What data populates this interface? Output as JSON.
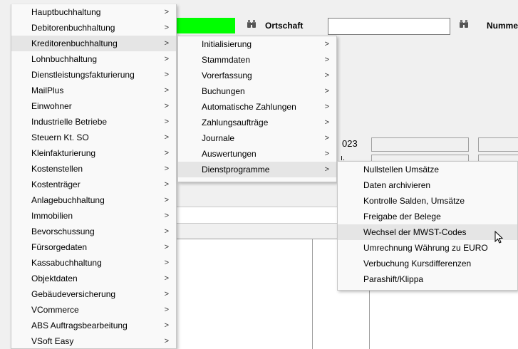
{
  "background": {
    "green_field_color": "#00ff00",
    "ortschaft_label": "Ortschaft",
    "nummer_label": "Nummer",
    "partial_value": "023",
    "partial_value2": "ı."
  },
  "menu_level1": {
    "items": [
      {
        "label": "Hauptbuchhaltung",
        "arrow": ">"
      },
      {
        "label": "Debitorenbuchhaltung",
        "arrow": ">"
      },
      {
        "label": "Kreditorenbuchhaltung",
        "arrow": ">"
      },
      {
        "label": "Lohnbuchhaltung",
        "arrow": ">"
      },
      {
        "label": "Dienstleistungsfakturierung",
        "arrow": ">"
      },
      {
        "label": "MailPlus",
        "arrow": ">"
      },
      {
        "label": "Einwohner",
        "arrow": ">"
      },
      {
        "label": "Industrielle Betriebe",
        "arrow": ">"
      },
      {
        "label": "Steuern Kt. SO",
        "arrow": ">"
      },
      {
        "label": "Kleinfakturierung",
        "arrow": ">"
      },
      {
        "label": "Kostenstellen",
        "arrow": ">"
      },
      {
        "label": "Kostenträger",
        "arrow": ">"
      },
      {
        "label": "Anlagebuchhaltung",
        "arrow": ">"
      },
      {
        "label": "Immobilien",
        "arrow": ">"
      },
      {
        "label": "Bevorschussung",
        "arrow": ">"
      },
      {
        "label": "Fürsorgedaten",
        "arrow": ">"
      },
      {
        "label": "Kassabuchhaltung",
        "arrow": ">"
      },
      {
        "label": "Objektdaten",
        "arrow": ">"
      },
      {
        "label": "Gebäudeversicherung",
        "arrow": ">"
      },
      {
        "label": "VCommerce",
        "arrow": ">"
      },
      {
        "label": "ABS Auftragsbearbeitung",
        "arrow": ">"
      },
      {
        "label": "VSoft Easy",
        "arrow": ">"
      }
    ]
  },
  "menu_level2": {
    "items": [
      {
        "label": "Initialisierung",
        "arrow": ">"
      },
      {
        "label": "Stammdaten",
        "arrow": ">"
      },
      {
        "label": "Vorerfassung",
        "arrow": ">"
      },
      {
        "label": "Buchungen",
        "arrow": ">"
      },
      {
        "label": "Automatische Zahlungen",
        "arrow": ">"
      },
      {
        "label": "Zahlungsaufträge",
        "arrow": ">"
      },
      {
        "label": "Journale",
        "arrow": ">"
      },
      {
        "label": "Auswertungen",
        "arrow": ">"
      },
      {
        "label": "Dienstprogramme",
        "arrow": ">"
      }
    ]
  },
  "menu_level3": {
    "items": [
      {
        "label": "Nullstellen Umsätze"
      },
      {
        "label": "Daten archivieren"
      },
      {
        "label": "Kontrolle Salden, Umsätze"
      },
      {
        "label": "Freigabe der Belege"
      },
      {
        "label": "Wechsel der MWST-Codes"
      },
      {
        "label": "Umrechnung Währung zu EURO"
      },
      {
        "label": "Verbuchung Kursdifferenzen"
      },
      {
        "label": "Parashift/Klippa"
      }
    ]
  },
  "colors": {
    "menu_bg": "#f9f9f9",
    "highlight": "#e5e5e5"
  }
}
